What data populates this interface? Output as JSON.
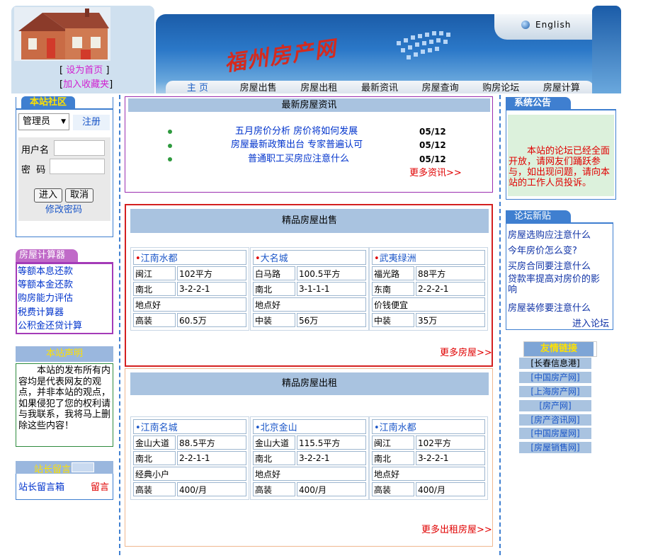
{
  "header": {
    "set_home": "设为首页",
    "add_favorite": "加入收藏夹",
    "site_logo": "福州房产网",
    "english": "English",
    "nav": [
      "主 页",
      "房屋出售",
      "房屋出租",
      "最新资讯",
      "房屋查询",
      "购房论坛",
      "房屋计算"
    ]
  },
  "left": {
    "community_title": "本站社区",
    "role_select": "管理员",
    "register": "注册",
    "username_label": "用户名",
    "password_label": "密  码",
    "login": "进入",
    "cancel": "取消",
    "change_password": "修改密码",
    "calc_title": "房屋计算器",
    "calc_items": [
      "等额本息还款",
      "等额本金还款",
      "购房能力评估",
      "税费计算器",
      "公积金还贷计算"
    ],
    "statement_title": "本站声明",
    "statement_text": "本站的发布所有内容均是代表网友的观点，并非本站的观点，如果侵犯了您的权利请与我联系，我将马上删除这些内容！",
    "contact_link": "与我联系",
    "guestbook_title": "站长留言",
    "guestbook_link": "站长留言箱",
    "guestbook_btn": "留言"
  },
  "news": {
    "title": "最新房屋资讯",
    "items": [
      {
        "text": "五月房价分析 房价将如何发展",
        "date": "05/12"
      },
      {
        "text": "房屋最新政策出台 专家普遍认可",
        "date": "05/12"
      },
      {
        "text": "普通职工买房应注意什么",
        "date": "05/12"
      }
    ],
    "more": "更多资讯>>"
  },
  "sale": {
    "title": "精品房屋出售",
    "more": "更多房屋>>",
    "cards": [
      {
        "name": "江南水都",
        "road": "闽江",
        "area": "102平方",
        "dir": "南北",
        "layout": "3-2-2-1",
        "feature": "地点好",
        "deco": "高装",
        "price": "60.5万"
      },
      {
        "name": "大名城",
        "road": "白马路",
        "area": "100.5平方",
        "dir": "南北",
        "layout": "3-1-1-1",
        "feature": "地点好",
        "deco": "中装",
        "price": "56万"
      },
      {
        "name": "武夷绿洲",
        "road": "福光路",
        "area": "88平方",
        "dir": "东南",
        "layout": "2-2-2-1",
        "feature": "价钱便宜",
        "deco": "中装",
        "price": "35万"
      }
    ]
  },
  "rent": {
    "title": "精品房屋出租",
    "more": "更多出租房屋>>",
    "cards": [
      {
        "name": "江南名城",
        "road": "金山大道",
        "area": "88.5平方",
        "dir": "南北",
        "layout": "2-2-1-1",
        "feature": "经典小户",
        "deco": "高装",
        "price": "400/月"
      },
      {
        "name": "北京金山",
        "road": "金山大道",
        "area": "115.5平方",
        "dir": "南北",
        "layout": "3-2-2-1",
        "feature": "地点好",
        "deco": "高装",
        "price": "400/月"
      },
      {
        "name": "江南水都",
        "road": "闽江",
        "area": "102平方",
        "dir": "南北",
        "layout": "3-2-2-1",
        "feature": "地点好",
        "deco": "高装",
        "price": "400/月"
      }
    ]
  },
  "right": {
    "notice_title": "系统公告",
    "notice_text": "本站的论坛已经全面开放，请网友们踊跃参与，如出现问题，请向本站的工作人员投诉。",
    "forum_title": "论坛新贴",
    "forum_items": [
      "房屋选购应注意什么",
      "今年房价怎么变?",
      "买房合同要注意什么",
      "贷款率提高对房价的影响",
      "房屋装修要注意什么"
    ],
    "forum_enter": "进入论坛",
    "links_title": "友情链接",
    "links": [
      "[长春信息港]",
      "[中国房产网]",
      "[上海房产网]",
      "[房产网]",
      "[房产咨讯网]",
      "[中国房屋网]",
      "[房屋销售网]"
    ]
  },
  "colors": {
    "accent": "#3f7fd0",
    "red": "#e00000",
    "purple": "#9b2fb0",
    "green": "#2e8b3e"
  }
}
